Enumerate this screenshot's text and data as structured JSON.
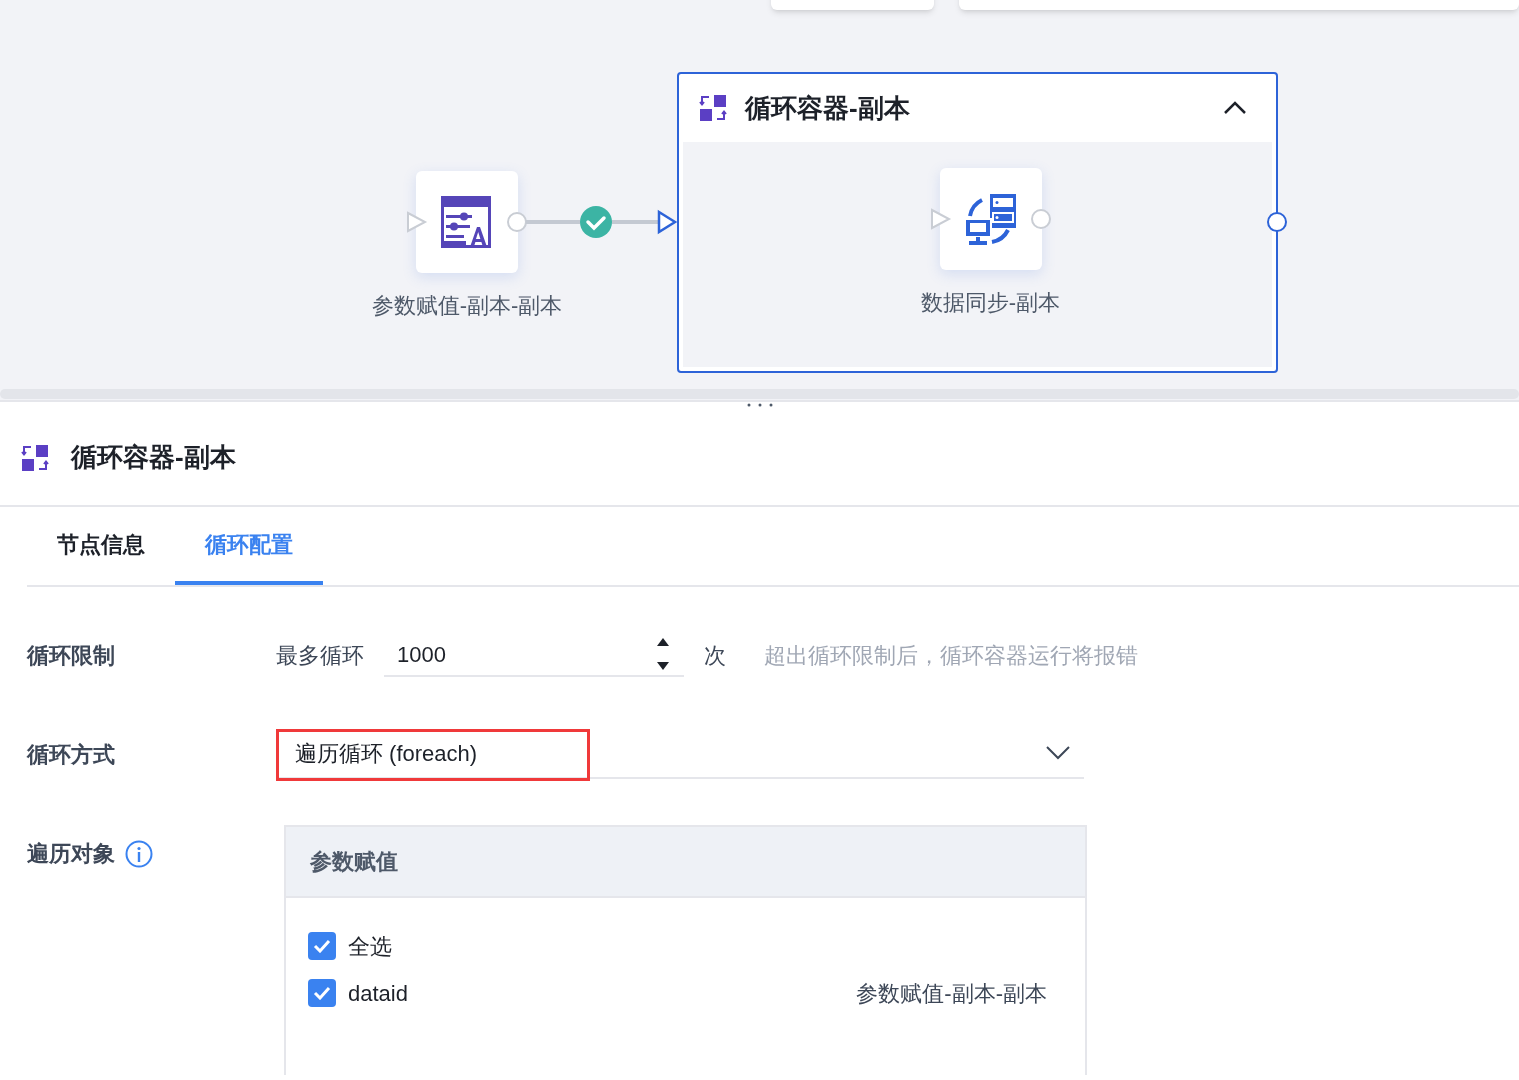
{
  "canvas": {
    "nodes": [
      {
        "label": "参数赋值-副本-副本",
        "kind": "assign"
      }
    ],
    "edge": {
      "succeeded": true
    },
    "container": {
      "title": "循环容器-副本",
      "expanded": true,
      "nodes": [
        {
          "label": "数据同步-副本",
          "kind": "sync"
        }
      ]
    }
  },
  "panel": {
    "title": "循环容器-副本",
    "tabs": [
      {
        "label": "节点信息",
        "selected": false
      },
      {
        "label": "循环配置",
        "selected": true
      }
    ],
    "loop_limit": {
      "label": "循环限制",
      "prefix": "最多循环",
      "value": "1000",
      "unit": "次",
      "hint": "超出循环限制后，循环容器运行将报错"
    },
    "loop_mode": {
      "label": "循环方式",
      "value": "遍历循环 (foreach)",
      "highlighted": true
    },
    "iterate": {
      "label": "遍历对象",
      "table_header": "参数赋值",
      "items": [
        {
          "label": "全选",
          "checked": true
        },
        {
          "label": "dataid",
          "source": "参数赋值-副本-副本",
          "checked": true
        }
      ]
    }
  }
}
